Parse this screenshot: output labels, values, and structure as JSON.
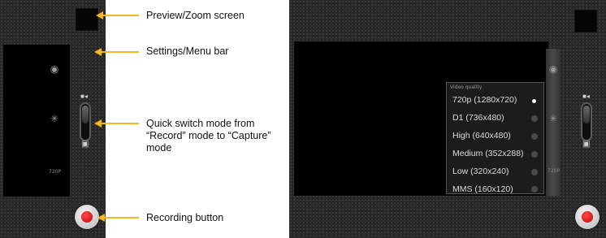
{
  "annotations": {
    "preview_zoom": "Preview/Zoom screen",
    "settings_menu": "Settings/Menu bar",
    "quick_switch": [
      "Quick switch mode from",
      "“Record” mode to “Capture”",
      "mode"
    ],
    "recording": "Recording button"
  },
  "left_camera": {
    "menu_icons": [
      "◉",
      "✳"
    ],
    "resolution": "720P",
    "video_mode_icon": "■◂",
    "camera_mode_icon": "▣"
  },
  "right_camera": {
    "menu_icons": [
      "◉",
      "✳"
    ],
    "resolution": "720P",
    "video_mode_icon": "■◂",
    "camera_mode_icon": "▣",
    "video_quality": {
      "title": "Video quality",
      "options": [
        "720p (1280x720)",
        "D1 (736x480)",
        "High (640x480)",
        "Medium (352x288)",
        "Low (320x240)",
        "MMS (160x120)"
      ],
      "selected": "720p (1280x720)"
    }
  },
  "colors": {
    "arrow": "#f2b820",
    "record": "#d00000"
  }
}
